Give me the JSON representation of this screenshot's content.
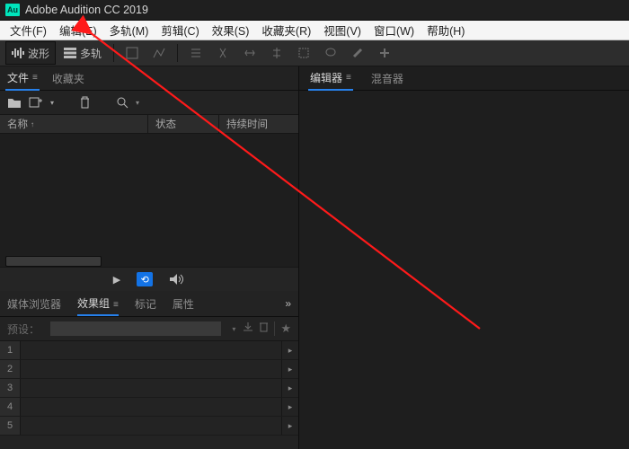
{
  "app": {
    "title": "Adobe Audition CC 2019",
    "logo": "Au"
  },
  "menu": [
    "文件(F)",
    "编辑(E)",
    "多轨(M)",
    "剪辑(C)",
    "效果(S)",
    "收藏夹(R)",
    "视图(V)",
    "窗口(W)",
    "帮助(H)"
  ],
  "mode_tabs": {
    "waveform": "波形",
    "multitrack": "多轨"
  },
  "files_panel": {
    "tab_files": "文件",
    "tab_fav": "收藏夹",
    "header_name": "名称",
    "header_status": "状态",
    "header_duration": "持续时间"
  },
  "bottom_panel": {
    "tab_media": "媒体浏览器",
    "tab_fxgroup": "效果组",
    "tab_markers": "标记",
    "tab_props": "属性",
    "preset_label": "预设：",
    "rows": [
      "1",
      "2",
      "3",
      "4",
      "5"
    ]
  },
  "right_panel": {
    "tab_editor": "编辑器",
    "tab_mixer": "混音器"
  }
}
